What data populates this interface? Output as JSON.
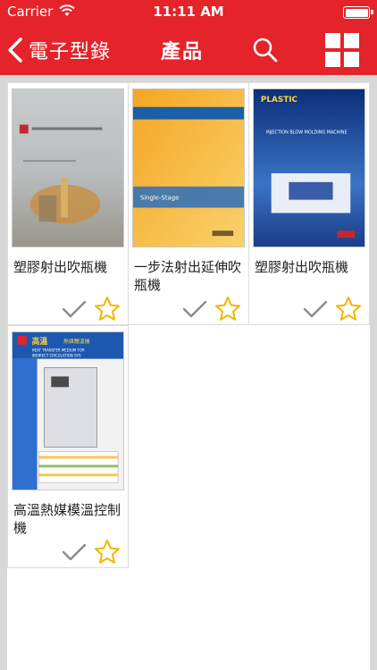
{
  "status_bar": {
    "carrier": "Carrier",
    "time": "11:11 AM"
  },
  "nav_bar": {
    "back_label": "電子型錄",
    "title": "產品",
    "icons": [
      "chevron-left-icon",
      "search-icon",
      "grid-view-icon"
    ]
  },
  "products": [
    {
      "name": "塑膠射出吹瓶機",
      "cover_text": []
    },
    {
      "name": "一步法射出延伸吹瓶機",
      "cover_text": [
        "Single-Stage"
      ]
    },
    {
      "name": "塑膠射出吹瓶機",
      "cover_text": [
        "PLASTIC",
        "INJECTION BLOW MOLDING MACHINE"
      ]
    },
    {
      "name": "高溫熱媒模溫控制機",
      "cover_text": [
        "高溫",
        "熱媒體溫機",
        "HEAT TRANSFER MEDIUM FOR",
        "INDIRECT CIRCULATION SYS"
      ]
    }
  ],
  "colors": {
    "brand_red": "#e4232a",
    "star_yellow": "#f4b400",
    "check_gray": "#8a8a8a"
  }
}
